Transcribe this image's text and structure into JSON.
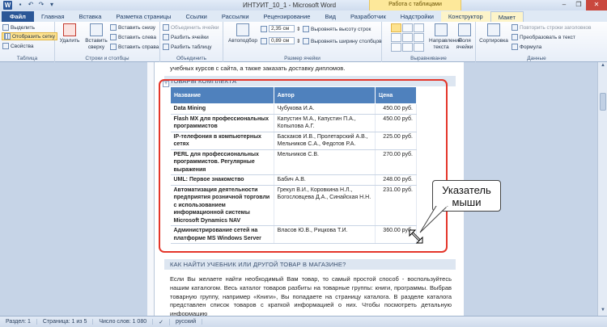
{
  "window": {
    "title": "ИНТУИТ_10_1 - Microsoft Word",
    "context_title": "Работа с таблицами",
    "app_icon": "W"
  },
  "tabs": [
    "Файл",
    "Главная",
    "Вставка",
    "Разметка страницы",
    "Ссылки",
    "Рассылки",
    "Рецензирование",
    "Вид",
    "Разработчик",
    "Надстройки",
    "Конструктор",
    "Макет"
  ],
  "ribbon": {
    "table_group": {
      "label": "Таблица",
      "select": "Выделить",
      "show_grid": "Отобразить сетку",
      "properties": "Свойства"
    },
    "rows_cols_group": {
      "label": "Строки и столбцы",
      "delete": "Удалить",
      "insert_above": "Вставить сверху",
      "insert_below": "Вставить снизу",
      "insert_left": "Вставить слева",
      "insert_right": "Вставить справа"
    },
    "merge_group": {
      "label": "Объединить",
      "merge_cells": "Объединить ячейки",
      "split_cells": "Разбить ячейки",
      "split_table": "Разбить таблицу"
    },
    "cell_size_group": {
      "label": "Размер ячейки",
      "autofit": "Автоподбор",
      "height": "2,35 см",
      "width": "0,89 см",
      "distribute_rows": "Выровнять высоту строк",
      "distribute_cols": "Выровнять ширину столбцов"
    },
    "alignment_group": {
      "label": "Выравнивание",
      "text_direction": "Направление текста",
      "cell_margins": "Поля ячейки"
    },
    "data_group": {
      "label": "Данные",
      "sort": "Сортировка",
      "repeat_header": "Повторить строки заголовков",
      "convert": "Преобразовать в текст",
      "formula": "Формула"
    }
  },
  "document": {
    "top_text": "учебных курсов с сайта, а также заказать доставку дипломов.",
    "heading1": "ТОВАРЫ КОМПЛЕКТА",
    "heading2": "КАК НАЙТИ УЧЕБНИК ИЛИ ДРУГОЙ ТОВАР В МАГАЗИНЕ?",
    "table": {
      "headers": [
        "Название",
        "Автор",
        "Цена"
      ],
      "rows": [
        [
          "Data Mining",
          "Чубукова И.А.",
          "450.00 руб."
        ],
        [
          "Flash MX для профессиональных программистов",
          "Капустин М.А., Капустин П.А., Копылова А.Г.",
          "450.00 руб."
        ],
        [
          "IP-телефония в компьютерных сетях",
          "Баскаков И.В., Пролетарский А.В., Мельников С.А., Федотов Р.А.",
          "225.00 руб."
        ],
        [
          "PERL для профессиональных программистов. Регулярные выражения",
          "Мельников С.В.",
          "270.00 руб."
        ],
        [
          "UML: Первое знакомство",
          "Бабич А.В.",
          "248.00 руб."
        ],
        [
          "Автоматизация деятельности предприятия розничной торговли с использованием информационной системы Microsoft Dynamics NAV",
          "Грекул В.И., Коровкина Н.Л., Богословцева Д.А., Синайская Н.Н.",
          "231.00 руб."
        ],
        [
          "Администрирование сетей на платформе MS Windows Server",
          "Власов Ю.В., Рицкова Т.И.",
          "360.00 руб."
        ]
      ]
    },
    "callout": "Указатель мыши",
    "paragraph": "Если Вы желаете найти необходимый Вам товар, то самый простой способ - воспользуйтесь нашим каталогом. Весь каталог товаров разбиты на товарные группы: книги, программы. Выбрав товарную группу, например «Книги», Вы попадаете на страницу каталога. В разделе каталога представлен список товаров с краткой информацией о них. Чтобы посмотреть детальную информацию"
  },
  "statusbar": {
    "section": "Раздел: 1",
    "page": "Страница: 1 из 5",
    "words": "Число слов: 1 080",
    "language": "русский"
  },
  "colors": {
    "table_header": "#4f81bd",
    "highlight_frame": "#e4362a",
    "file_tab": "#2b5797"
  }
}
